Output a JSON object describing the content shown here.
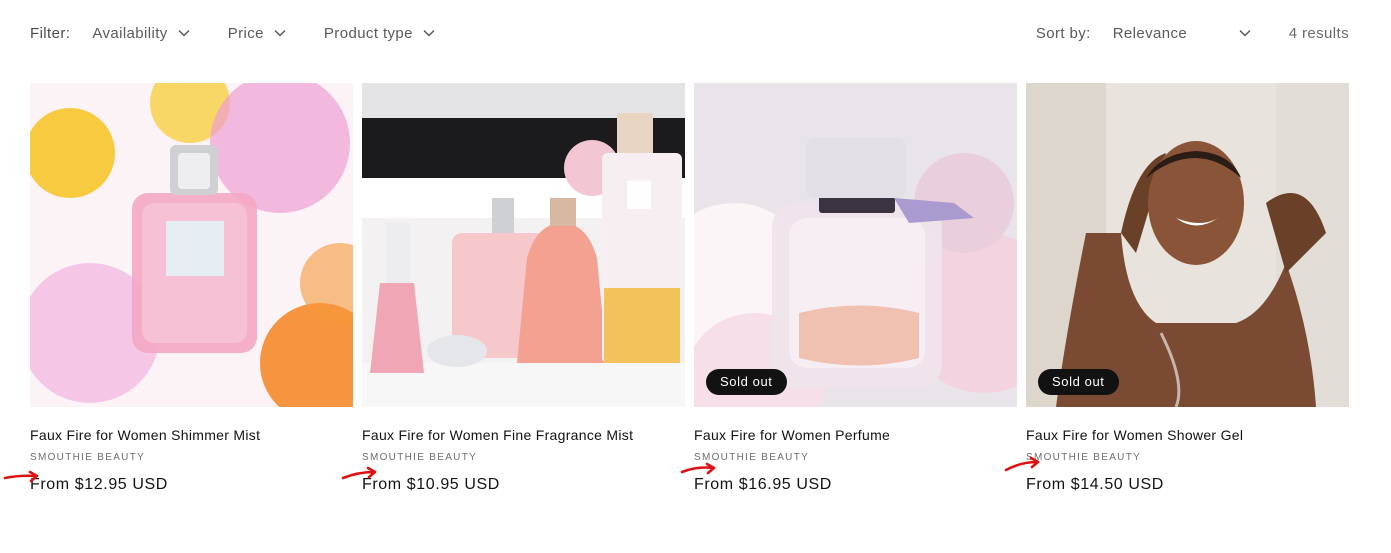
{
  "filter": {
    "label": "Filter:",
    "facets": [
      {
        "label": "Availability"
      },
      {
        "label": "Price"
      },
      {
        "label": "Product type"
      }
    ]
  },
  "sort": {
    "label": "Sort by:",
    "selected": "Relevance"
  },
  "results_count": "4 results",
  "products": [
    {
      "title": "Faux Fire for Women Shimmer Mist",
      "vendor": "SMOUTHIE BEAUTY",
      "price": "From $12.95 USD",
      "badge": ""
    },
    {
      "title": "Faux Fire for Women Fine Fragrance Mist",
      "vendor": "SMOUTHIE BEAUTY",
      "price": "From $10.95 USD",
      "badge": ""
    },
    {
      "title": "Faux Fire for Women Perfume",
      "vendor": "SMOUTHIE BEAUTY",
      "price": "From $16.95 USD",
      "badge": "Sold out"
    },
    {
      "title": "Faux Fire for Women Shower Gel",
      "vendor": "SMOUTHIE BEAUTY",
      "price": "From $14.50 USD",
      "badge": "Sold out"
    }
  ],
  "colors": {
    "badge_bg": "#121212",
    "annotation": "#e01010"
  }
}
